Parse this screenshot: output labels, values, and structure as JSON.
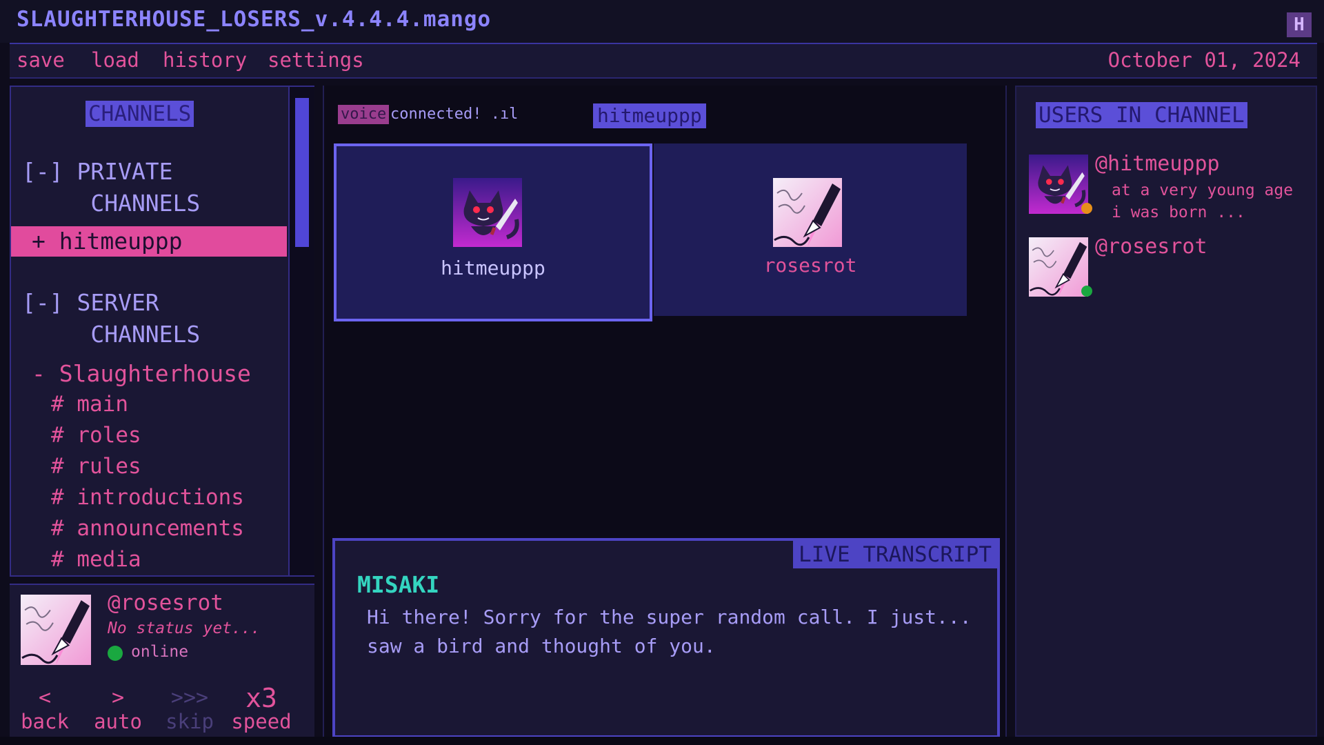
{
  "window": {
    "title": "SLAUGHTERHOUSE_LOSERS_v.4.4.4.mango",
    "close_label": "H"
  },
  "menu": {
    "items": [
      "save",
      "load",
      "history",
      "settings"
    ],
    "date": "October 01, 2024"
  },
  "sidebar": {
    "header": "CHANNELS",
    "private_category": "[-] PRIVATE\n     CHANNELS",
    "private_items": [
      "+ hitmeuppp"
    ],
    "server_category": "[-] SERVER\n     CHANNELS",
    "server_name": "- Slaughterhouse",
    "channels": [
      "# main",
      "# roles",
      "# rules",
      "# introductions",
      "# announcements",
      "# media"
    ]
  },
  "profile": {
    "handle": "@rosesrot",
    "status": "No status yet...",
    "presence": "online",
    "presence_color": "#1aa840"
  },
  "controls": [
    {
      "icon": "<",
      "label": "back",
      "enabled": true
    },
    {
      "icon": ">",
      "label": "auto",
      "enabled": true
    },
    {
      "icon": ">>>",
      "label": "skip",
      "enabled": false
    },
    {
      "icon": "x3",
      "label": "speed",
      "enabled": true
    }
  ],
  "voice": {
    "badge": "voice",
    "status": "connected! .ıl",
    "room": "hitmeuppp",
    "participants": [
      {
        "name": "hitmeuppp",
        "avatar_icon": "cat-with-knife-icon",
        "active": true
      },
      {
        "name": "rosesrot",
        "avatar_icon": "fountain-pen-icon",
        "active": false
      }
    ]
  },
  "transcript": {
    "label": "LIVE TRANSCRIPT",
    "speaker": "MISAKI",
    "text": "Hi there! Sorry for the super random call. I just... saw a bird and thought of you."
  },
  "users_panel": {
    "header": "USERS IN CHANNEL",
    "users": [
      {
        "handle": "@hitmeuppp",
        "status": "at a very young age i was born ...",
        "dot_color": "#e7901a",
        "avatar_icon": "cat-with-knife-icon"
      },
      {
        "handle": "@rosesrot",
        "status": "",
        "dot_color": "#1aa840",
        "avatar_icon": "fountain-pen-icon"
      }
    ]
  },
  "colors": {
    "accent_pink": "#e2539b",
    "accent_purple": "#5b4fd8",
    "accent_teal": "#34d5c0",
    "background": "#0e0c1c"
  }
}
